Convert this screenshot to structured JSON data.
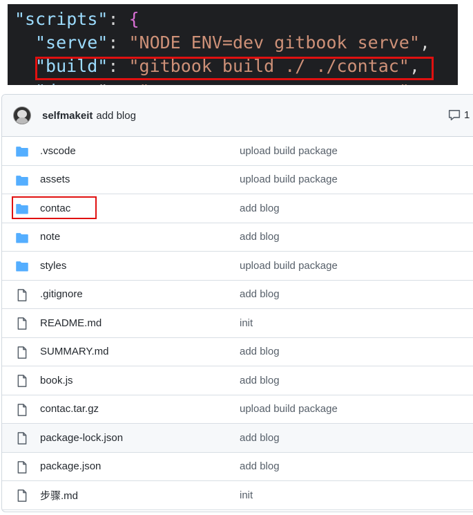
{
  "code": {
    "lines": [
      {
        "key": "\"scripts\"",
        "sep": ": ",
        "brace": "{"
      },
      {
        "key": "\"serve\"",
        "sep": ": ",
        "value": "\"NODE ENV=dev gitbook serve\"",
        "end": ","
      },
      {
        "key": "\"build\"",
        "sep": ": ",
        "value": "\"gitbook build ./ ./contac\"",
        "end": ","
      }
    ]
  },
  "commit": {
    "author": "selfmakeit",
    "message": "add blog",
    "comments": "1"
  },
  "files": [
    {
      "type": "folder",
      "name": ".vscode",
      "message": "upload build package"
    },
    {
      "type": "folder",
      "name": "assets",
      "message": "upload build package"
    },
    {
      "type": "folder",
      "name": "contac",
      "message": "add blog"
    },
    {
      "type": "folder",
      "name": "note",
      "message": "add blog"
    },
    {
      "type": "folder",
      "name": "styles",
      "message": "upload build package"
    },
    {
      "type": "file",
      "name": ".gitignore",
      "message": "add blog"
    },
    {
      "type": "file",
      "name": "README.md",
      "message": "init"
    },
    {
      "type": "file",
      "name": "SUMMARY.md",
      "message": "add blog"
    },
    {
      "type": "file",
      "name": "book.js",
      "message": "add blog"
    },
    {
      "type": "file",
      "name": "contac.tar.gz",
      "message": "upload build package"
    },
    {
      "type": "file",
      "name": "package-lock.json",
      "message": "add blog"
    },
    {
      "type": "file",
      "name": "package.json",
      "message": "add blog"
    },
    {
      "type": "file",
      "name": "步骤.md",
      "message": "init"
    }
  ],
  "colors": {
    "highlight": "#e01010",
    "folder": "#54aeff",
    "file_icon": "#57606a"
  }
}
